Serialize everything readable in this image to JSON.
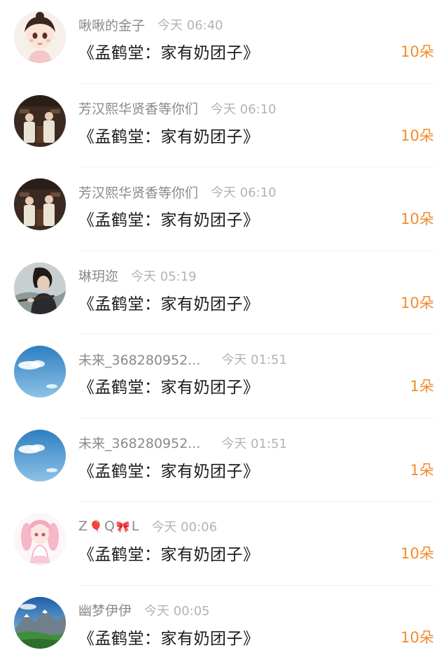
{
  "gifts": [
    {
      "username": "啾啾的金子",
      "time": "今天 06:40",
      "content": "《孟鹤堂：家有奶团子》",
      "count": "10朵",
      "avatar_icon": "cartoon-girl-avatar-icon"
    },
    {
      "username": "芳汉熙华贤香等你们",
      "time": "今天 06:10",
      "content": "《孟鹤堂：家有奶团子》",
      "count": "10朵",
      "avatar_icon": "stage-performers-avatar-icon"
    },
    {
      "username": "芳汉熙华贤香等你们",
      "time": "今天 06:10",
      "content": "《孟鹤堂：家有奶团子》",
      "count": "10朵",
      "avatar_icon": "stage-performers-avatar-icon"
    },
    {
      "username": "琳玥迩",
      "time": "今天 05:19",
      "content": "《孟鹤堂：家有奶团子》",
      "count": "10朵",
      "avatar_icon": "flute-player-avatar-icon"
    },
    {
      "username": "未来_368280952...",
      "time": "今天 01:51",
      "content": "《孟鹤堂：家有奶团子》",
      "count": "1朵",
      "avatar_icon": "blue-sky-avatar-icon"
    },
    {
      "username": "未来_368280952...",
      "time": "今天 01:51",
      "content": "《孟鹤堂：家有奶团子》",
      "count": "1朵",
      "avatar_icon": "blue-sky-avatar-icon"
    },
    {
      "username_parts": [
        "Z",
        "Q",
        "L"
      ],
      "time": "今天 00:06",
      "content": "《孟鹤堂：家有奶团子》",
      "count": "10朵",
      "avatar_icon": "pink-anime-girl-avatar-icon"
    },
    {
      "username": "幽梦伊伊",
      "time": "今天 00:05",
      "content": "《孟鹤堂：家有奶团子》",
      "count": "10朵",
      "avatar_icon": "mountain-landscape-avatar-icon"
    }
  ],
  "colors": {
    "count": "#f28b2c",
    "username": "#8a8a8a",
    "time": "#b3b3b3",
    "content": "#1c1c1c",
    "divider": "#f1f1f1"
  }
}
